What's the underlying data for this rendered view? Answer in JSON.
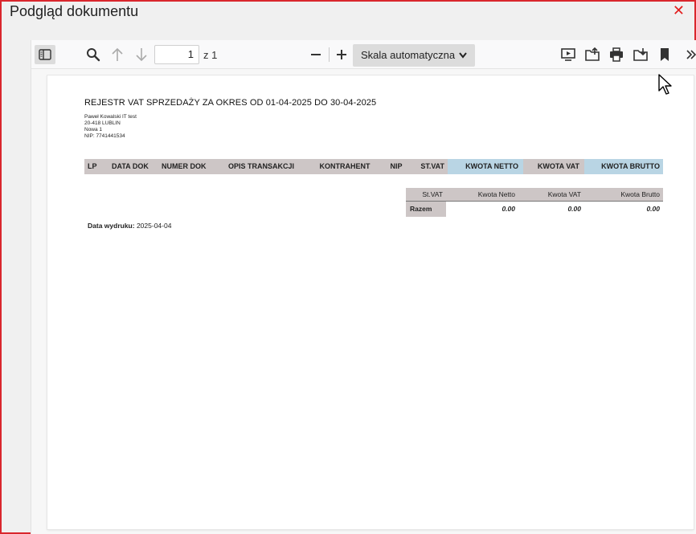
{
  "dialog": {
    "title": "Podgląd dokumentu",
    "close_glyph": "✕"
  },
  "toolbar": {
    "page_number": "1",
    "page_of": "z 1",
    "scale": "Skala automatyczna",
    "icons": [
      "sidebar-toggle-icon",
      "search-icon",
      "arrow-up-icon",
      "arrow-down-icon",
      "minus-icon",
      "plus-icon",
      "chevron-down-icon",
      "presentation-icon",
      "open-file-icon",
      "print-icon",
      "download-icon",
      "bookmark-icon",
      "more-icon"
    ]
  },
  "document": {
    "title": "REJESTR VAT SPRZEDAŻY ZA OKRES OD 01-04-2025 DO 30-04-2025",
    "company": {
      "line1": "Paweł Kowalski IT test",
      "line2": "20-418 LUBLIN",
      "line3": "Nowa 1",
      "line4": "NIP: 7741441534"
    },
    "register_columns": [
      "LP",
      "DATA DOK",
      "NUMER DOK",
      "OPIS TRANSAKCJI",
      "KONTRAHENT",
      "NIP",
      "ST.VAT",
      "KWOTA NETTO",
      "KWOTA VAT",
      "KWOTA BRUTTO"
    ],
    "summary": {
      "headers": [
        "St.VAT",
        "Kwota Netto",
        "Kwota VAT",
        "Kwota Brutto"
      ],
      "row_label": "Razem",
      "values": [
        "0.00",
        "0.00",
        "0.00"
      ]
    },
    "print_date_label": "Data wydruku:",
    "print_date_value": "2025-04-04"
  },
  "colors": {
    "frame": "#d9262d",
    "header_gray": "#cdc6c6",
    "header_blue": "#b9d5e4",
    "close": "#e21b1b"
  }
}
